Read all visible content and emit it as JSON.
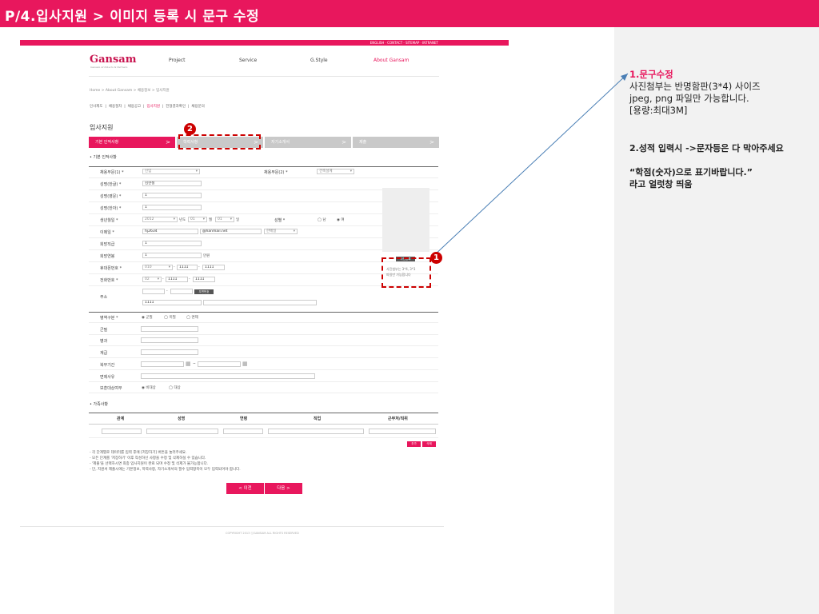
{
  "slide": {
    "title": "P/4.입사지원 > 이미지 등록 시 문구 수정"
  },
  "notes": {
    "n1_title": "1.문구수정",
    "n1_l1": "사진첨부는 반명함판(3*4) 사이즈",
    "n1_l2": "jpeg, png 파일만 가능합니다.",
    "n1_l3": "[용량:최대3M]",
    "n2_l1": "2.성적 입력시 ->문자등은 다 막아주세요",
    "n2_l2": "“학점(숫자)으로 표기바랍니다.”",
    "n2_l3": "라고 얼럿창 띄움"
  },
  "site": {
    "util_links": "ENGLISH · CONTACT · SITEMAP · INTRANET",
    "logo": "Gansam",
    "logo_sub": "Gansam Architects & Partners",
    "gnb": [
      "Project",
      "Service",
      "G.Style",
      "About Gansam"
    ],
    "breadcrumb": "Home > About Gansam > 채용정보 > 입사지원",
    "subnav": [
      "인사제도",
      "채용절차",
      "채용공고",
      "입사지원",
      "전형결과확인",
      "채용문의"
    ],
    "page_title": "입사지원",
    "steps": [
      "기본 인적사항",
      "학력사항",
      "자기소개서",
      "제출"
    ],
    "section_basic": "• 기본 인적사항",
    "labels": {
      "job1": "채용부문(1) *",
      "job2": "채용부문(2) *",
      "name_kr": "성명(한글) *",
      "name_en": "성명(영문) *",
      "name_cn": "성명(한자) *",
      "birth": "생년월일 *",
      "gender": "성별 *",
      "email": "이메일 *",
      "pos": "희망직급",
      "salary": "희망연봉",
      "mobile": "휴대폰번호 *",
      "phone": "전화번호 *",
      "addr": "주소"
    },
    "values": {
      "job1": "신입",
      "job2": "건축설계",
      "name_kr": "김현철",
      "name_en": "1",
      "name_cn": "1",
      "birth_y": "2012",
      "birth_y_u": "년도",
      "birth_m": "01",
      "birth_m_u": "월",
      "birth_d": "01",
      "birth_d_u": "일",
      "gender_m": "◯ 남",
      "gender_f": "◉ 여",
      "email_id": "hj2634",
      "email_dom": "@hanmail.net",
      "email_sel": "한메일",
      "pos": "1",
      "salary": "1",
      "salary_unit": "만원",
      "mob1": "010",
      "mob2": "1111",
      "mob3": "1111",
      "tel1": "02",
      "tel2": "1111",
      "tel3": "1111",
      "addr_btn": "우편번호",
      "addr_detail": "1111",
      "dash": "-"
    },
    "photo_btn": "사진등록",
    "photo_note_1": "사진첨부는 3*4, 3*3",
    "photo_note_2": "파일만 가능합니다",
    "military": {
      "label": "병역구분 *",
      "opt1": "◉ 군필",
      "opt2": "◯ 미필",
      "opt3": "◯ 면제",
      "branch": "군필",
      "rank": "병과",
      "class": "계급",
      "period": "복무기간",
      "exempt": "면제사유",
      "vet": "보훈대상여부",
      "vet_opt1": "◉ 비대상",
      "vet_opt2": "◯ 대상",
      "tilde": "~"
    },
    "family": {
      "title": "• 가족사항",
      "cols": [
        "관계",
        "성명",
        "연령",
        "직업",
        "근무처/직위"
      ],
      "add": "추가",
      "del": "삭제"
    },
    "help": [
      "- 각 단계별로 데이터를 입력 후에 [저장하기] 버튼을 눌러주세요.",
      "- 모든 단계를 '저장하기' 이후 작성하신 사항을 수정 및 삭제하실 수 있습니다.",
      "- '제출'을 선택하시면 최종 입사지원이 완료 되며 수정 및 삭제가 불가능합니다.",
      "- 단, 지원서 제출시에는 기본정보, 학력사항, 자기소개서의 필수 입력항목이 모두 입력되어야 합니다."
    ],
    "prev": "< 이전",
    "next": "다음 >",
    "copyright": "COPYRIGHT 2013 ⓒGANSAM ALL RIGHTS RESERVED",
    "badge1": "1",
    "badge2": "2"
  }
}
